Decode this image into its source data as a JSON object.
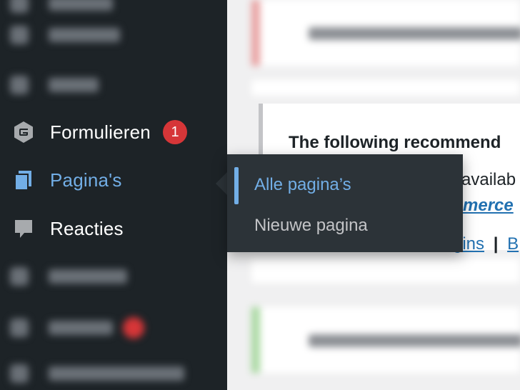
{
  "sidebar": {
    "items": [
      {
        "label": "Formulieren",
        "icon": "gravity-forms-icon",
        "badge": "1"
      },
      {
        "label": "Pagina's",
        "icon": "pages-icon",
        "current": true
      },
      {
        "label": "Reacties",
        "icon": "comments-icon"
      }
    ]
  },
  "flyout": {
    "items": [
      {
        "label": "Alle pagina’s",
        "current": true
      },
      {
        "label": "Nieuwe pagina"
      }
    ]
  },
  "notice": {
    "line1": "The following recommend",
    "line2_suffix": "availab",
    "line3_link": "merce",
    "line4_link": "gins",
    "line4_sep": "|",
    "line4_link2": "B"
  },
  "colors": {
    "sidebar_bg": "#1d2327",
    "accent": "#72aee6",
    "badge": "#d63638",
    "flyout_bg": "#2c3338"
  }
}
